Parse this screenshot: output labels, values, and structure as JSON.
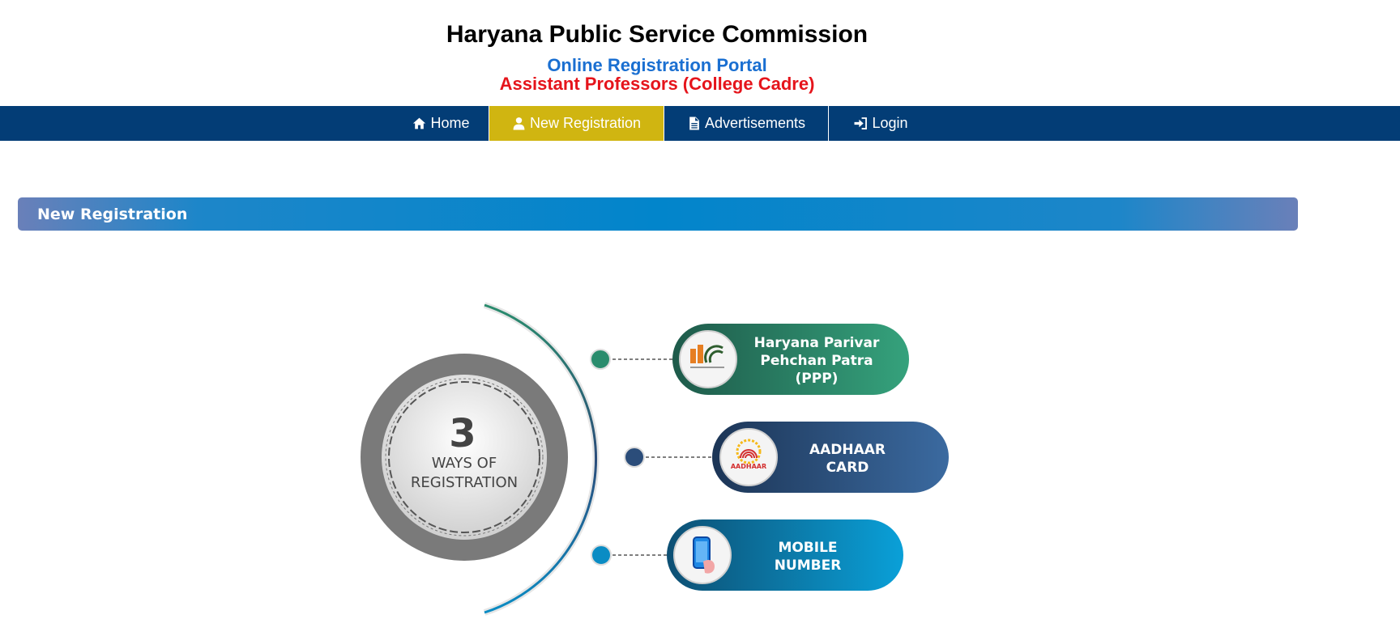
{
  "header": {
    "title": "Haryana Public Service Commission",
    "subtitle": "Online Registration Portal",
    "subtitle2": "Assistant Professors (College Cadre)"
  },
  "nav": {
    "items": [
      {
        "label": "Home",
        "icon": "home-icon"
      },
      {
        "label": "New Registration",
        "icon": "user-icon",
        "active": true
      },
      {
        "label": "Advertisements",
        "icon": "file-icon"
      },
      {
        "label": "Login",
        "icon": "login-icon"
      }
    ]
  },
  "section": {
    "title": "New Registration"
  },
  "infographic": {
    "center_number": "3",
    "center_line1": "WAYS OF",
    "center_line2": "REGISTRATION",
    "options": [
      {
        "line1": "Haryana Parivar",
        "line2": "Pehchan Patra",
        "line3": "(PPP)",
        "logo": "ppp-logo",
        "color": "#2a8c6d"
      },
      {
        "line1": "AADHAAR",
        "line2": "CARD",
        "logo": "aadhaar-logo",
        "logo_text": "AADHAAR",
        "color": "#2b4d7a"
      },
      {
        "line1": "MOBILE",
        "line2": "NUMBER",
        "logo": "mobile-icon",
        "color": "#0a8cc4"
      }
    ]
  },
  "colors": {
    "navbar": "#033d76",
    "nav_active": "#d0b511",
    "subtitle": "#1a6fd1",
    "subtitle2": "#e5141b"
  }
}
